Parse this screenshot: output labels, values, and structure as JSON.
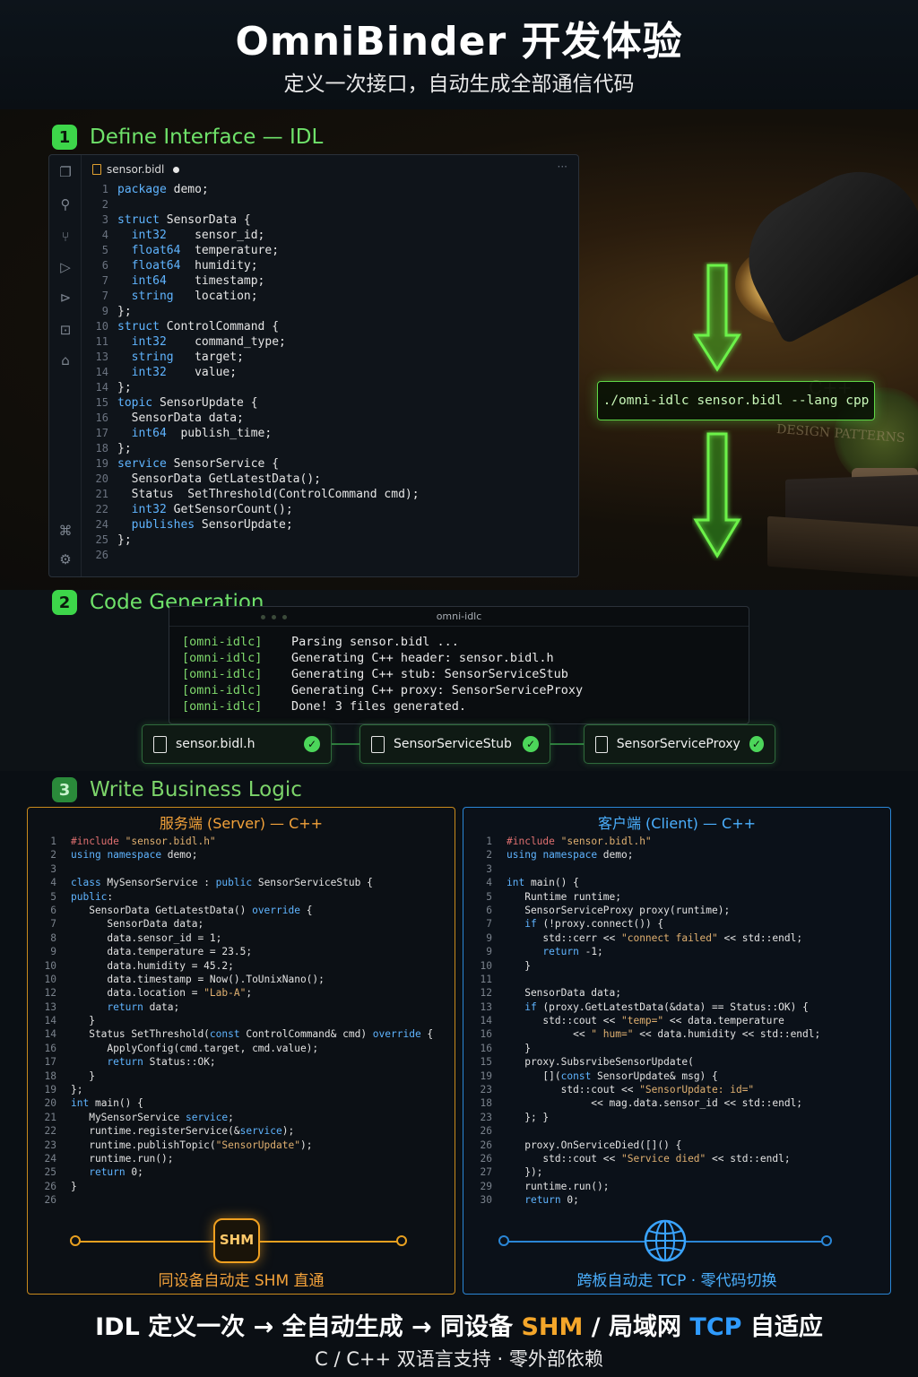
{
  "header": {
    "title": "OmniBinder 开发体验",
    "subtitle": "定义一次接口，自动生成全部通信代码"
  },
  "section1": {
    "num": "1",
    "label": "Define Interface — IDL",
    "editor": {
      "tab_name": "sensor.bidl",
      "more": "···",
      "lines": [
        {
          "n": "1",
          "t": "package demo;"
        },
        {
          "n": "2",
          "t": ""
        },
        {
          "n": "3",
          "t": "struct SensorData {"
        },
        {
          "n": "4",
          "t": "  int32    sensor_id;"
        },
        {
          "n": "5",
          "t": "  float64  temperature;"
        },
        {
          "n": "6",
          "t": "  float64  humidity;"
        },
        {
          "n": "7",
          "t": "  int64    timestamp;"
        },
        {
          "n": "7",
          "t": "  string   location;"
        },
        {
          "n": "9",
          "t": "};"
        },
        {
          "n": "10",
          "t": "struct ControlCommand {"
        },
        {
          "n": "11",
          "t": "  int32    command_type;"
        },
        {
          "n": "13",
          "t": "  string   target;"
        },
        {
          "n": "14",
          "t": "  int32    value;"
        },
        {
          "n": "14",
          "t": "};"
        },
        {
          "n": "15",
          "t": "topic SensorUpdate {"
        },
        {
          "n": "16",
          "t": "  SensorData data;"
        },
        {
          "n": "17",
          "t": "  int64  publish_time;"
        },
        {
          "n": "18",
          "t": "};"
        },
        {
          "n": "19",
          "t": "service SensorService {"
        },
        {
          "n": "20",
          "t": "  SensorData GetLatestData();"
        },
        {
          "n": "21",
          "t": "  Status  SetThreshold(ControlCommand cmd);"
        },
        {
          "n": "22",
          "t": "  int32 GetSensorCount();"
        },
        {
          "n": "24",
          "t": "  publishes SensorUpdate;"
        },
        {
          "n": "25",
          "t": "};"
        },
        {
          "n": "26",
          "t": ""
        }
      ]
    },
    "command": "./omni-idlc sensor.bidl --lang cpp",
    "book1": "C++",
    "book2": "DESIGN PATTERNS"
  },
  "section2": {
    "num": "2",
    "label": "Code Generation",
    "terminal": {
      "title": "omni-idlc",
      "lines": [
        {
          "p": "[omni-idlc]",
          "m": "Parsing sensor.bidl ..."
        },
        {
          "p": "[omni-idlc]",
          "m": "Generating C++ header: sensor.bidl.h"
        },
        {
          "p": "[omni-idlc]",
          "m": "Generating C++ stub: SensorServiceStub"
        },
        {
          "p": "[omni-idlc]",
          "m": "Generating C++ proxy: SensorServiceProxy"
        },
        {
          "p": "[omni-idlc]",
          "m": "Done! 3 files generated."
        }
      ]
    },
    "files": [
      "sensor.bidl.h",
      "SensorServiceStub",
      "SensorServiceProxy"
    ]
  },
  "section3": {
    "num": "3",
    "label": "Write Business Logic",
    "server": {
      "title": "服务端 (Server) — C++",
      "lines": [
        {
          "n": "1",
          "t": "#include \"sensor.bidl.h\""
        },
        {
          "n": "2",
          "t": "using namespace demo;"
        },
        {
          "n": "3",
          "t": ""
        },
        {
          "n": "4",
          "t": "class MySensorService : public SensorServiceStub {"
        },
        {
          "n": "5",
          "t": "public:"
        },
        {
          "n": "6",
          "t": "   SensorData GetLatestData() override {"
        },
        {
          "n": "7",
          "t": "      SensorData data;"
        },
        {
          "n": "8",
          "t": "      data.sensor_id = 1;"
        },
        {
          "n": "9",
          "t": "      data.temperature = 23.5;"
        },
        {
          "n": "10",
          "t": "      data.humidity = 45.2;"
        },
        {
          "n": "10",
          "t": "      data.timestamp = Now().ToUnixNano();"
        },
        {
          "n": "12",
          "t": "      data.location = \"Lab-A\";"
        },
        {
          "n": "13",
          "t": "      return data;"
        },
        {
          "n": "14",
          "t": "   }"
        },
        {
          "n": "14",
          "t": "   Status SetThreshold(const ControlCommand& cmd) override {"
        },
        {
          "n": "16",
          "t": "      ApplyConfig(cmd.target, cmd.value);"
        },
        {
          "n": "17",
          "t": "      return Status::OK;"
        },
        {
          "n": "18",
          "t": "   }"
        },
        {
          "n": "19",
          "t": "};"
        },
        {
          "n": "20",
          "t": "int main() {"
        },
        {
          "n": "21",
          "t": "   MySensorService service;"
        },
        {
          "n": "22",
          "t": "   runtime.registerService(&service);"
        },
        {
          "n": "23",
          "t": "   runtime.publishTopic(\"SensorUpdate\");"
        },
        {
          "n": "24",
          "t": "   runtime.run();"
        },
        {
          "n": "25",
          "t": "   return 0;"
        },
        {
          "n": "26",
          "t": "}"
        },
        {
          "n": "26",
          "t": ""
        }
      ],
      "badge": "SHM",
      "foot": "同设备自动走 SHM 直通"
    },
    "client": {
      "title": "客户端 (Client) — C++",
      "lines": [
        {
          "n": "1",
          "t": "#include \"sensor.bidl.h\""
        },
        {
          "n": "2",
          "t": "using namespace demo;"
        },
        {
          "n": "3",
          "t": ""
        },
        {
          "n": "4",
          "t": "int main() {"
        },
        {
          "n": "5",
          "t": "   Runtime runtime;"
        },
        {
          "n": "6",
          "t": "   SensorServiceProxy proxy(runtime);"
        },
        {
          "n": "7",
          "t": "   if (!proxy.connect()) {"
        },
        {
          "n": "9",
          "t": "      std::cerr << \"connect failed\" << std::endl;"
        },
        {
          "n": "9",
          "t": "      return -1;"
        },
        {
          "n": "10",
          "t": "   }"
        },
        {
          "n": "11",
          "t": ""
        },
        {
          "n": "12",
          "t": "   SensorData data;"
        },
        {
          "n": "13",
          "t": "   if (proxy.GetLatestData(&data) == Status::OK) {"
        },
        {
          "n": "14",
          "t": "      std::cout << \"temp=\" << data.temperature"
        },
        {
          "n": "16",
          "t": "           << \" hum=\" << data.humidity << std::endl;"
        },
        {
          "n": "16",
          "t": "   }"
        },
        {
          "n": "15",
          "t": "   proxy.SubsrvibeSensorUpdate("
        },
        {
          "n": "19",
          "t": "      [](const SensorUpdate& msg) {"
        },
        {
          "n": "23",
          "t": "         std::cout << \"SensorUpdate: id=\""
        },
        {
          "n": "18",
          "t": "              << mag.data.sensor_id << std::endl;"
        },
        {
          "n": "23",
          "t": "   }; }"
        },
        {
          "n": "26",
          "t": ""
        },
        {
          "n": "26",
          "t": "   proxy.OnServiceDied([]() {"
        },
        {
          "n": "26",
          "t": "      std::cout << \"Service died\" << std::endl;"
        },
        {
          "n": "27",
          "t": "   });"
        },
        {
          "n": "29",
          "t": "   runtime.run();"
        },
        {
          "n": "30",
          "t": "   return 0;"
        }
      ],
      "foot": "跨板自动走 TCP · 零代码切换"
    }
  },
  "footer": {
    "tag_a": "IDL 定义一次 → 全自动生成 → 同设备 ",
    "tag_shm": "SHM",
    "tag_b": " / 局域网 ",
    "tag_tcp": "TCP",
    "tag_c": " 自适应",
    "sub": "C / C++ 双语言支持 · 零外部依赖"
  },
  "colors": {
    "green": "#6fe26a",
    "server_orange": "#f3a23a",
    "client_blue": "#4bb0ff"
  }
}
